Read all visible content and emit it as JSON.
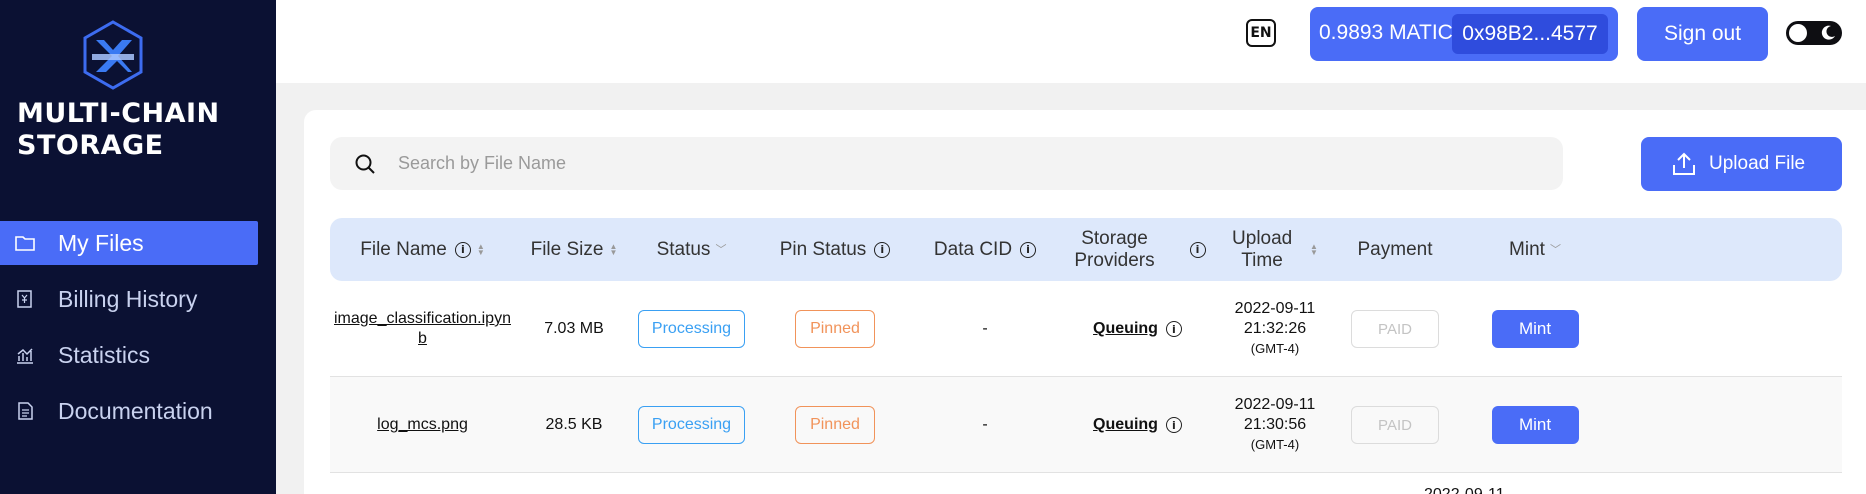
{
  "brand": {
    "line1": "MULTI-CHAIN",
    "line2": "STORAGE"
  },
  "sidebar": {
    "items": [
      {
        "label": "My Files",
        "icon": "folder-icon"
      },
      {
        "label": "Billing History",
        "icon": "billing-icon"
      },
      {
        "label": "Statistics",
        "icon": "chart-icon"
      },
      {
        "label": "Documentation",
        "icon": "document-icon"
      }
    ],
    "active_index": 0
  },
  "header": {
    "lang": "EN",
    "balance": "0.9893 MATIC",
    "address": "0x98B2...4577",
    "sign_out": "Sign out"
  },
  "search": {
    "placeholder": "Search by File Name"
  },
  "upload": {
    "label": "Upload File"
  },
  "table": {
    "headers": {
      "file_name": "File Name",
      "file_size": "File Size",
      "status": "Status",
      "pin_status": "Pin Status",
      "data_cid": "Data CID",
      "storage_providers": "Storage Providers",
      "upload_time": "Upload Time",
      "payment": "Payment",
      "mint": "Mint"
    },
    "rows": [
      {
        "file_name": "image_classification.ipynb",
        "file_size": "7.03 MB",
        "status": "Processing",
        "pin_status": "Pinned",
        "data_cid": "-",
        "storage": "Queuing",
        "date": "2022-09-11",
        "time": "21:32:26",
        "tz": "(GMT-4)",
        "payment": "PAID",
        "mint": "Mint"
      },
      {
        "file_name": "log_mcs.png",
        "file_size": "28.5 KB",
        "status": "Processing",
        "pin_status": "Pinned",
        "data_cid": "-",
        "storage": "Queuing",
        "date": "2022-09-11",
        "time": "21:30:56",
        "tz": "(GMT-4)",
        "payment": "PAID",
        "mint": "Mint"
      }
    ],
    "partial_next_date": "2022-09-11"
  },
  "colors": {
    "accent": "#4a6cf7",
    "sidebar_bg": "#0b1133",
    "processing": "#3aa0f3",
    "pinned": "#f1935a"
  }
}
